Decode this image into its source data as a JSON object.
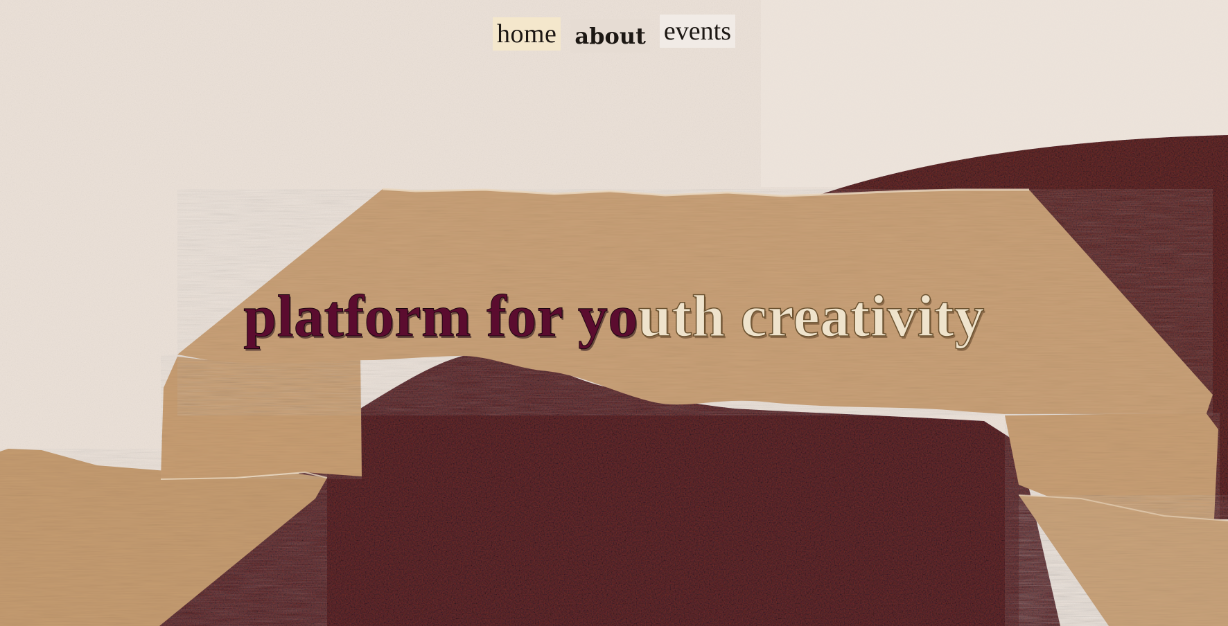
{
  "nav": {
    "items": [
      {
        "label": "home"
      },
      {
        "label": "about"
      },
      {
        "label": "events"
      }
    ]
  },
  "hero": {
    "headline_dark": "platform for yo",
    "headline_light": "uth creativity"
  },
  "colors": {
    "background_paper": "#ece2d9",
    "kraft_paper": "#c39a6e",
    "speckled_fabric": "#5a2a28",
    "headline_dark": "#5b0c2f",
    "headline_light": "#efe3cc"
  }
}
